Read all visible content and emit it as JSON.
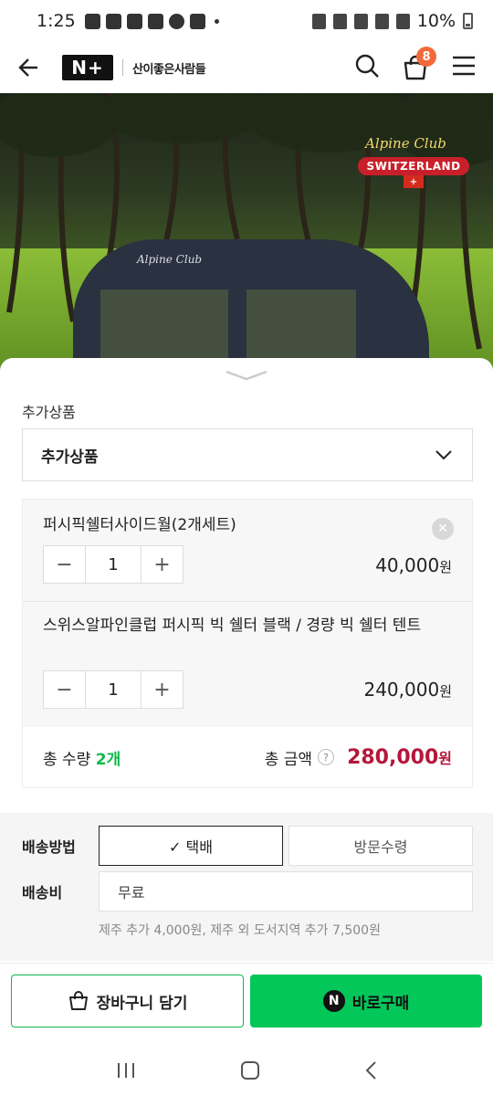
{
  "status_bar": {
    "time": "1:25",
    "battery": "10%"
  },
  "header": {
    "logo": "N+",
    "store_name": "산이좋은사람들",
    "cart_count": "8"
  },
  "hero": {
    "brand_script": "Alpine Club",
    "brand_banner": "SWITZERLAND",
    "flag_cross": "+",
    "tent_label": "Alpine Club"
  },
  "option": {
    "section_label": "추가상품",
    "select_value": "추가상품"
  },
  "items": [
    {
      "title": "퍼시픽쉘터사이드월(2개세트)",
      "qty": "1",
      "price": "40,000",
      "unit": "원"
    },
    {
      "title": "스위스알파인클럽 퍼시픽 빅 쉘터 블랙 / 경량 빅 쉘터 텐트",
      "qty": "1",
      "price": "240,000",
      "unit": "원"
    }
  ],
  "summary": {
    "qty_label": "총 수량",
    "qty_value": "2개",
    "total_label": "총 금액",
    "help": "?",
    "total_price": "280,000",
    "unit": "원"
  },
  "shipping": {
    "method_label": "배송방법",
    "option_selected": "✓ 택배",
    "option_other": "방문수령",
    "fee_label": "배송비",
    "fee_value": "무료",
    "note": "제주 추가 4,000원, 제주 외 도서지역 추가 7,500원"
  },
  "actions": {
    "cart_label": "장바구니 담기",
    "buy_badge": "N",
    "buy_label": "바로구매"
  },
  "colors": {
    "naver_green": "#04c75a",
    "price_red": "#b5173a",
    "badge_orange": "#f26a3a"
  }
}
